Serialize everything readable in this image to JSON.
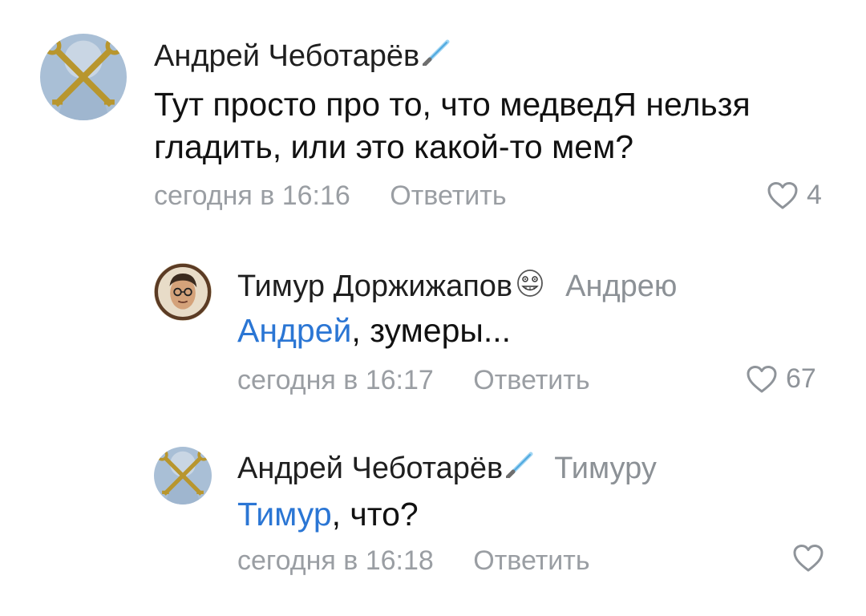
{
  "comments": [
    {
      "author": "Андрей Чеботарёв",
      "badge_icon": "lightsaber-icon",
      "reply_to": "",
      "mention": "",
      "text": "Тут просто про то, что медведЯ нельзя гладить, или это какой-то мем?",
      "timestamp": "сегодня в 16:16",
      "reply_label": "Ответить",
      "likes": "4"
    },
    {
      "author": "Тимур Доржижапов",
      "badge_icon": "meme-face-icon",
      "reply_to": "Андрею",
      "mention": "Андрей",
      "text": ", зумеры...",
      "timestamp": "сегодня в 16:17",
      "reply_label": "Ответить",
      "likes": "67"
    },
    {
      "author": "Андрей Чеботарёв",
      "badge_icon": "lightsaber-icon",
      "reply_to": "Тимуру",
      "mention": "Тимур",
      "text": ", что?",
      "timestamp": "сегодня в 16:18",
      "reply_label": "Ответить",
      "likes": ""
    }
  ],
  "colors": {
    "mention": "#2b76d4",
    "meta": "#9a9ea3",
    "text": "#111111"
  }
}
